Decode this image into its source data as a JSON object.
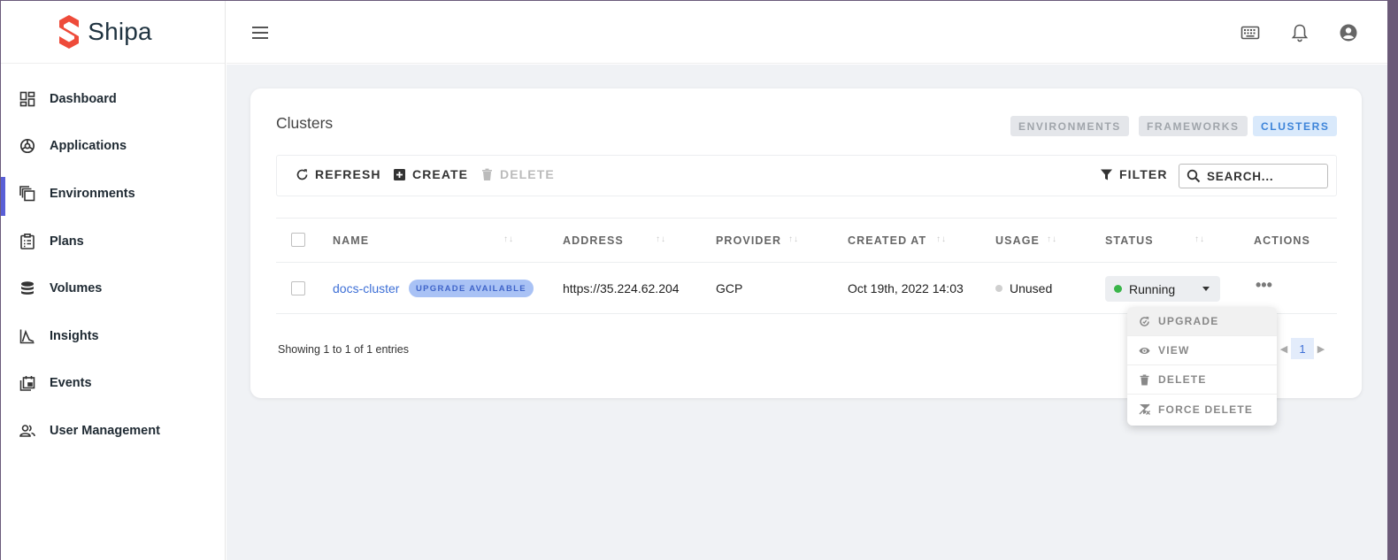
{
  "app": {
    "name": "Shipa"
  },
  "sidebar": {
    "items": [
      {
        "label": "Dashboard",
        "icon": "dashboard-icon"
      },
      {
        "label": "Applications",
        "icon": "applications-icon"
      },
      {
        "label": "Environments",
        "icon": "environments-icon",
        "active": true
      },
      {
        "label": "Plans",
        "icon": "plans-icon"
      },
      {
        "label": "Volumes",
        "icon": "volumes-icon"
      },
      {
        "label": "Insights",
        "icon": "insights-icon"
      },
      {
        "label": "Events",
        "icon": "events-icon"
      },
      {
        "label": "User Management",
        "icon": "users-icon"
      }
    ]
  },
  "topbar": {
    "icons": [
      "keyboard-icon",
      "bell-icon",
      "account-icon"
    ]
  },
  "page": {
    "title": "Clusters",
    "tabs": [
      {
        "label": "ENVIRONMENTS",
        "active": false
      },
      {
        "label": "FRAMEWORKS",
        "active": false
      },
      {
        "label": "CLUSTERS",
        "active": true
      }
    ]
  },
  "toolbar": {
    "refresh_label": "REFRESH",
    "create_label": "CREATE",
    "delete_label": "DELETE",
    "filter_label": "FILTER",
    "search_placeholder": "SEARCH..."
  },
  "table": {
    "columns": [
      "NAME",
      "ADDRESS",
      "PROVIDER",
      "CREATED AT",
      "USAGE",
      "STATUS",
      "ACTIONS"
    ],
    "sort_glyph": "↑↓",
    "rows": [
      {
        "name": "docs-cluster",
        "badge": "UPGRADE AVAILABLE",
        "address": "https://35.224.62.204",
        "provider": "GCP",
        "created_at": "Oct 19th, 2022 14:03",
        "usage": "Unused",
        "status": "Running",
        "actions_glyph": "•••"
      }
    ]
  },
  "footer": {
    "info": "Showing 1 to 1 of 1 entries",
    "current_page": "1"
  },
  "actions_menu": {
    "items": [
      {
        "label": "UPGRADE",
        "icon": "upgrade-icon"
      },
      {
        "label": "VIEW",
        "icon": "eye-icon"
      },
      {
        "label": "DELETE",
        "icon": "trash-icon"
      },
      {
        "label": "FORCE DELETE",
        "icon": "force-delete-icon"
      }
    ]
  },
  "colors": {
    "accent": "#5a5fd6",
    "link": "#3d6fd6",
    "running": "#3ab54a",
    "brand": "#ee4b3a"
  }
}
